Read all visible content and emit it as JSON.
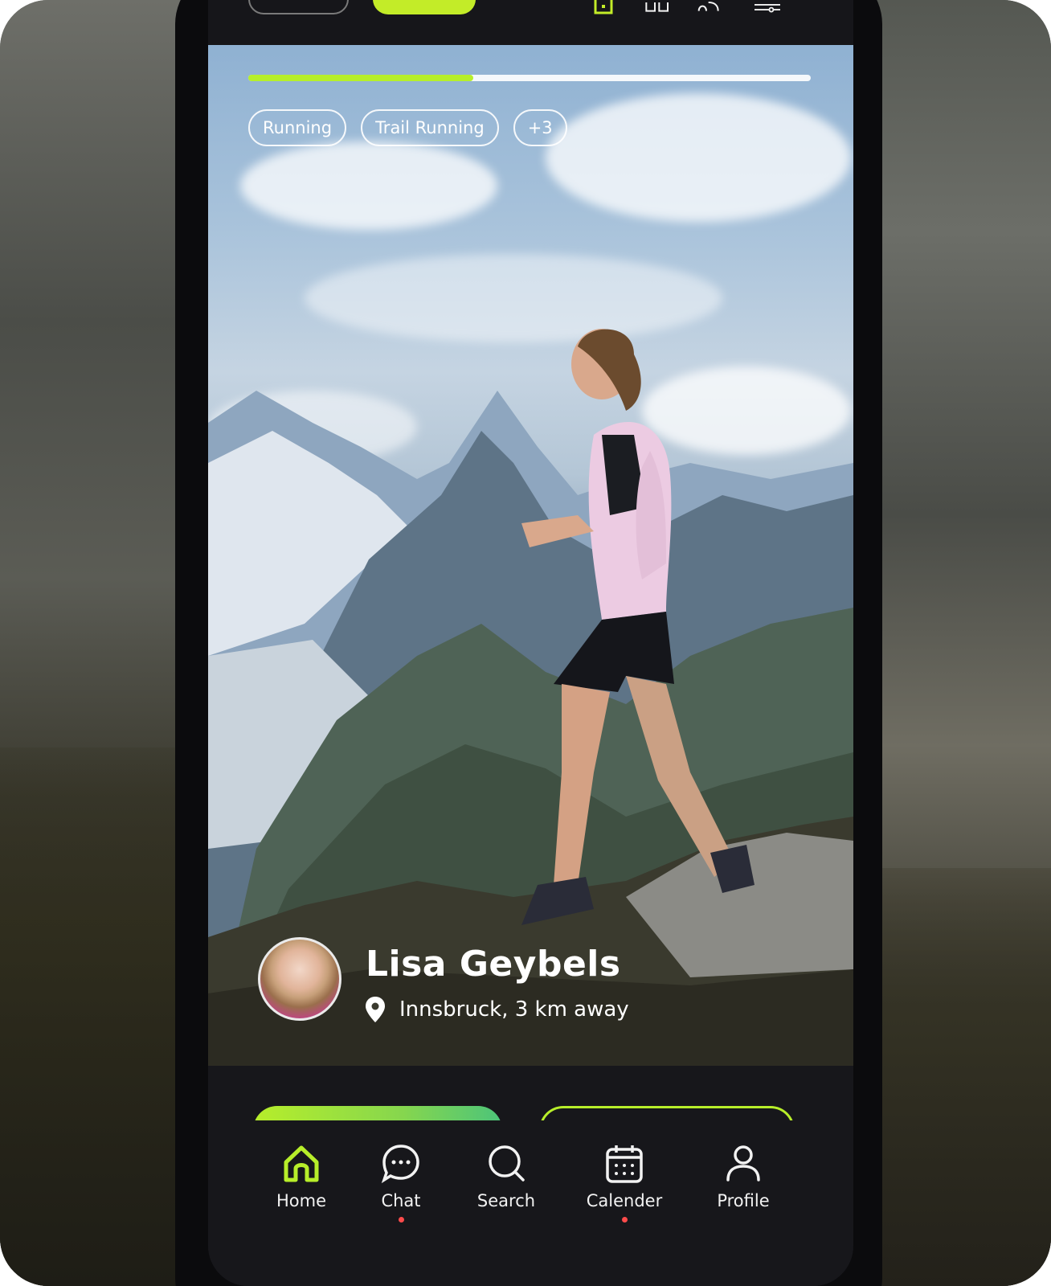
{
  "header": {
    "filter_tabs": [
      {
        "label": "",
        "state": "outlined"
      },
      {
        "label": "",
        "state": "active"
      }
    ]
  },
  "story": {
    "progress": 0.4,
    "tags": [
      "Running",
      "Trail Running",
      "+3"
    ]
  },
  "profile": {
    "name": "Lisa Geybels",
    "location": "Innsbruck, 3 km away"
  },
  "nav": {
    "items": [
      {
        "label": "Home",
        "icon": "home-icon",
        "active": true,
        "dot": false
      },
      {
        "label": "Chat",
        "icon": "chat-icon",
        "active": false,
        "dot": true
      },
      {
        "label": "Search",
        "icon": "search-icon",
        "active": false,
        "dot": false
      },
      {
        "label": "Calender",
        "icon": "calendar-icon",
        "active": false,
        "dot": true
      },
      {
        "label": "Profile",
        "icon": "profile-icon",
        "active": false,
        "dot": false
      }
    ]
  },
  "colors": {
    "accent": "#b7ee2a",
    "background": "#16161a",
    "notification_dot": "#ff4b4b"
  }
}
